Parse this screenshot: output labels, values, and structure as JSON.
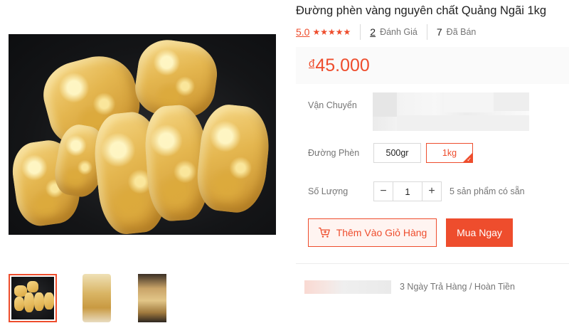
{
  "product": {
    "title": "Đường phèn vàng nguyên chất Quảng Ngãi 1kg",
    "rating": "5.0",
    "stars": "★★★★★",
    "review_count": "2",
    "review_label": "Đánh Giá",
    "sold_count": "7",
    "sold_label": "Đã Bán",
    "currency_symbol": "đ",
    "price": "45.000"
  },
  "shipping": {
    "label": "Vận Chuyển"
  },
  "variants": {
    "label": "Đường Phèn",
    "options": [
      "500gr",
      "1kg"
    ],
    "selected": "1kg"
  },
  "quantity": {
    "label": "Số Lượng",
    "minus": "−",
    "value": "1",
    "plus": "+",
    "stock": "5 sản phẩm có sẵn"
  },
  "actions": {
    "add_to_cart": "Thêm Vào Giỏ Hàng",
    "buy_now": "Mua Ngay"
  },
  "guarantee": {
    "text": "3 Ngày Trả Hàng / Hoàn Tiền"
  },
  "colors": {
    "accent": "#ee4d2d",
    "muted": "#757575"
  }
}
